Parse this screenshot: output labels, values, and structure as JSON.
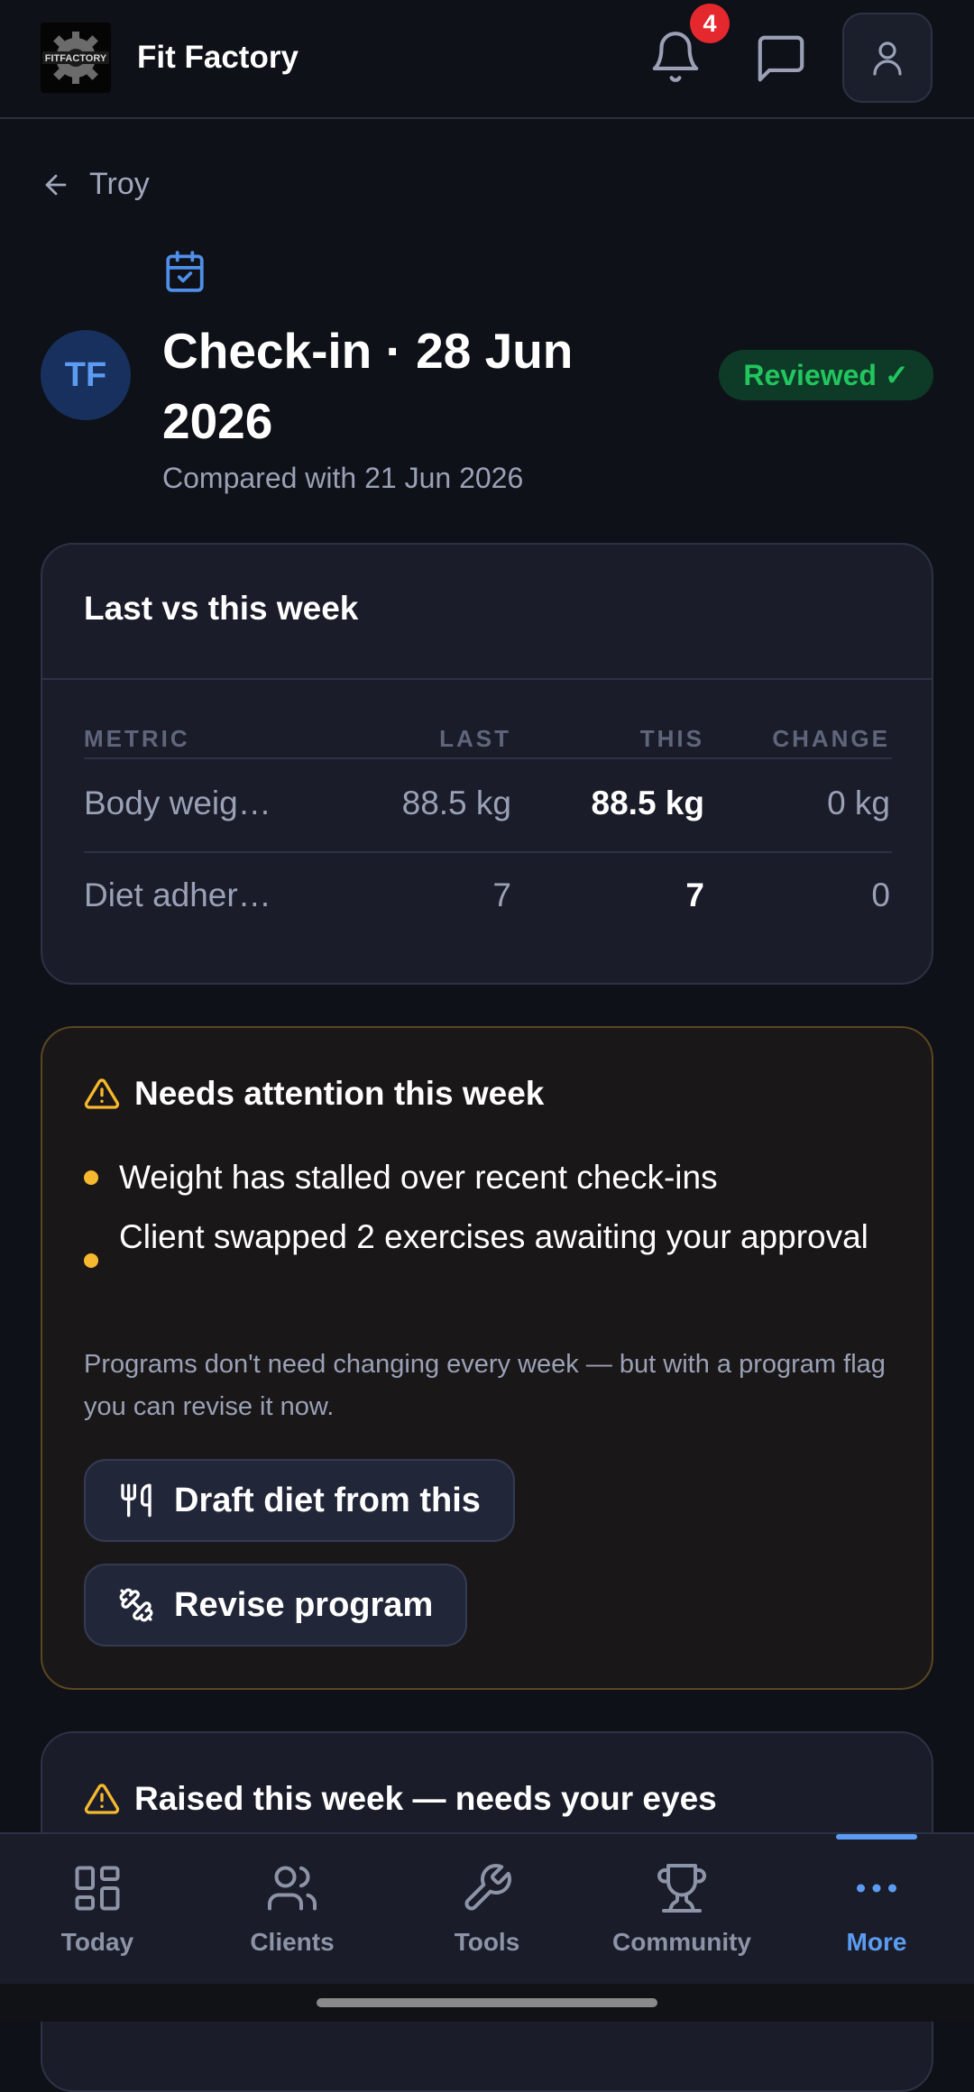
{
  "app": {
    "title": "Fit Factory",
    "logo_text": "FITFACTORY",
    "notification_count": "4"
  },
  "back": {
    "label": "Troy"
  },
  "header": {
    "title": "Check-in · 28 Jun 2026",
    "subtitle": "Compared with 21 Jun 2026",
    "avatar_initials": "TF",
    "status": "Reviewed ✓"
  },
  "comparison": {
    "title": "Last vs this week",
    "columns": [
      "METRIC",
      "LAST",
      "THIS",
      "CHANGE"
    ],
    "rows": [
      {
        "metric": "Body weig…",
        "last": "88.5 kg",
        "this": "88.5 kg",
        "change": "0 kg"
      },
      {
        "metric": "Diet adher…",
        "last": "7",
        "this": "7",
        "change": "0"
      }
    ]
  },
  "attention": {
    "title": "Needs attention this week",
    "items": [
      "Weight has stalled over recent check-ins",
      "Client swapped 2 exercises awaiting your approval"
    ],
    "note": "Programs don't need changing every week — but with a program flag you can revise it now.",
    "actions": {
      "draft_diet": "Draft diet from this",
      "revise_program": "Revise program"
    }
  },
  "raised": {
    "title": "Raised this week — needs your eyes"
  },
  "nav": {
    "items": [
      {
        "label": "Today",
        "icon": "dashboard-icon"
      },
      {
        "label": "Clients",
        "icon": "users-icon"
      },
      {
        "label": "Tools",
        "icon": "wrench-icon"
      },
      {
        "label": "Community",
        "icon": "trophy-icon"
      },
      {
        "label": "More",
        "icon": "more-icon"
      }
    ],
    "active": "More"
  },
  "colors": {
    "accent": "#5b9cf2",
    "success": "#22c55e",
    "warning": "#f5b82e",
    "badge": "#e5282d"
  }
}
